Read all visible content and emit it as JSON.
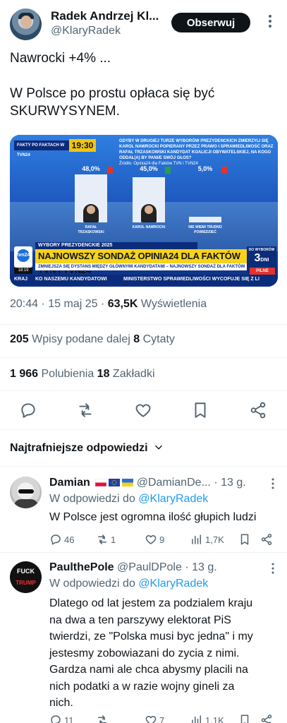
{
  "author": {
    "name": "Radek Andrzej Kl...",
    "handle": "@KlaryRadek",
    "follow_label": "Obserwuj"
  },
  "tweet": {
    "line1": "Nawrocki +4% ...",
    "line2": "W Polsce po prostu opłaca się być",
    "line3": "SKURWYSYNEM."
  },
  "media": {
    "tag_left": "FAKTY PO FAKTACH",
    "tag_channel": "W TVN24",
    "time": "19:30",
    "caption": "GDYBY W DRUGIEJ TURZE WYBORÓW PREZYDENCKICH ZMIERZYLI SIĘ KAROL NAWROCKI POPIERANY PRZEZ PRAWO I SPRAWIEDLIWOŚĆ ORAZ RAFAŁ TRZASKOWSKI KANDYDAT KOALICJI OBYWATELSKIEJ, NA KOGO ODDAŁ(A) BY PANI/E SWÓJ GŁOS?",
    "poll_source": "Źródło: Opinia24 dla Faktów TVN i TVN24",
    "strip_top": "WYBORY PREZYDENCKIE 2025",
    "strip_main": "NAJNOWSZY SONDAŻ OPINIA24 DLA FAKTÓW TVN I TVN24",
    "strip_sub": "ZMNIEJSZA SIĘ DYSTANS MIĘDZY GŁÓWNYMI KANDYDATAMI – NAJNOWSZY SONDAŻ DLA FAKTÓW TVN I TVN24",
    "strip_bottom_left": "KRAJ",
    "strip_bottom_text": "KO NASZEMU KANDYDATOWI",
    "strip_bottom_right": "MINISTERSTWO SPRAWIEDLIWOŚCI WYCOFUJE SIĘ Z LI",
    "tvn_logo": "tvn24",
    "tvn_time": "18:19",
    "countdown_label": "DO WYBORÓW",
    "countdown_value": "3",
    "countdown_unit": "DNI",
    "pilne": "PILNE",
    "bars": [
      {
        "label": "48,0%",
        "name": "RAFAŁ TRZASKOWSKI",
        "value": 48.0,
        "marker": "↓"
      },
      {
        "label": "45,0%",
        "name": "KAROL NAWROCKI",
        "value": 45.0,
        "marker": "↑"
      },
      {
        "label": "5,0%",
        "name": "NIE WIEM/ TRUDNO POWIEDZIEĆ",
        "value": 5.0,
        "marker": "↓"
      }
    ]
  },
  "meta": {
    "time": "20:44 · 15 maj 25 · ",
    "views": "63,5K",
    "views_label": " Wyświetlenia"
  },
  "stats": {
    "reposts": "205",
    "reposts_label": " Wpisy podane dalej  ",
    "quotes": "8",
    "quotes_label": " Cytaty",
    "likes": "1 966",
    "likes_label": " Polubienia  ",
    "bookmarks": "18",
    "bookmarks_label": " Zakładki"
  },
  "replies_header": "Najtrafniejsze odpowiedzi",
  "replies": [
    {
      "name": "Damian",
      "handle": "@DamianDe...",
      "time": "· 13 g.",
      "reply_to_prefix": "W odpowiedzi do ",
      "reply_to": "@KlaryRadek",
      "text": "W Polsce jest ogromna ilość głupich ludzi",
      "counts": {
        "comments": "46",
        "reposts": "1",
        "likes": "9",
        "views": "1,7K"
      }
    },
    {
      "name": "PaulthePole",
      "handle": "@PaulDPole",
      "time": "· 13 g.",
      "reply_to_prefix": "W odpowiedzi do ",
      "reply_to": "@KlaryRadek",
      "text_lines": [
        "Dlatego od lat jestem za podzialem kraju",
        "na dwa a ten parszywy elektorat PiS",
        "twierdzi, ze \"Polska musi byc jedna\" i my",
        "jestesmy zobowiazani do zycia z nimi.",
        "Gardza nami ale chca abysmy placili na",
        "nich podatki a w razie wojny gineli za",
        "nich."
      ],
      "counts": {
        "comments": "11",
        "reposts": "",
        "likes": "7",
        "views": "1,1K"
      },
      "avatar_text_top": "FUCK",
      "avatar_text_bottom": "TRUMP"
    }
  ]
}
